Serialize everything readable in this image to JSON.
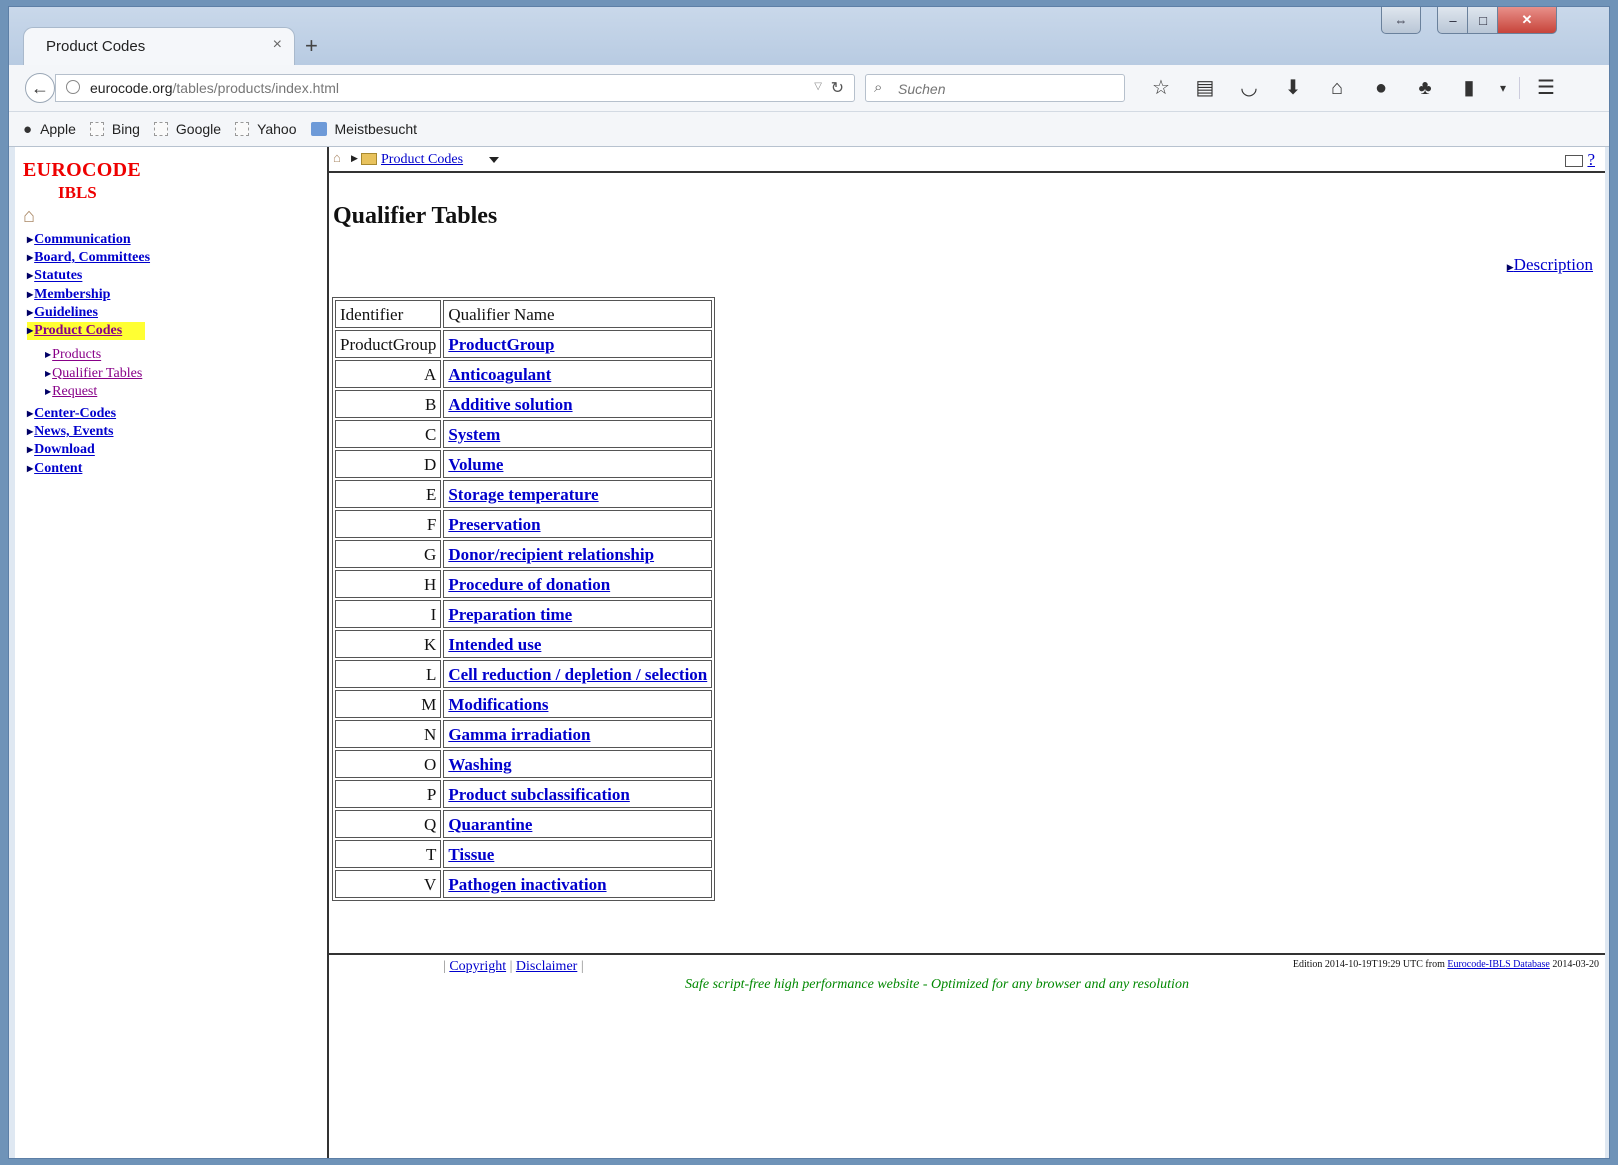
{
  "browser": {
    "tab_title": "Product Codes",
    "tab_close": "×",
    "new_tab": "+",
    "url_domain": "eurocode.org",
    "url_path": "/tables/products/index.html",
    "search_placeholder": "Suchen",
    "bookmarks": [
      "Apple",
      "Bing",
      "Google",
      "Yahoo",
      "Meistbesucht"
    ]
  },
  "sidebar": {
    "logo_line1": "EUROCODE",
    "logo_line2": "IBLS",
    "items": [
      {
        "label": "Communication"
      },
      {
        "label": "Board, Committees"
      },
      {
        "label": "Statutes"
      },
      {
        "label": "Membership"
      },
      {
        "label": "Guidelines"
      },
      {
        "label": "Product Codes"
      },
      {
        "label": "Center-Codes"
      },
      {
        "label": "News, Events"
      },
      {
        "label": "Download"
      },
      {
        "label": "Content"
      }
    ],
    "subitems": [
      {
        "label": "Products"
      },
      {
        "label": "Qualifier Tables"
      },
      {
        "label": "Request"
      }
    ]
  },
  "breadcrumb": {
    "link": "Product Codes"
  },
  "help": "?",
  "page": {
    "title": "Qualifier Tables",
    "description_link": "Description"
  },
  "table": {
    "headers": [
      "Identifier",
      "Qualifier Name"
    ],
    "rows": [
      {
        "id": "ProductGroup",
        "name": "ProductGroup"
      },
      {
        "id": "A",
        "name": "Anticoagulant"
      },
      {
        "id": "B",
        "name": "Additive solution"
      },
      {
        "id": "C",
        "name": "System"
      },
      {
        "id": "D",
        "name": "Volume"
      },
      {
        "id": "E",
        "name": "Storage temperature"
      },
      {
        "id": "F",
        "name": "Preservation"
      },
      {
        "id": "G",
        "name": "Donor/recipient relationship"
      },
      {
        "id": "H",
        "name": "Procedure of donation"
      },
      {
        "id": "I",
        "name": "Preparation time"
      },
      {
        "id": "K",
        "name": "Intended use"
      },
      {
        "id": "L",
        "name": "Cell reduction / depletion / selection"
      },
      {
        "id": "M",
        "name": "Modifications"
      },
      {
        "id": "N",
        "name": "Gamma irradiation"
      },
      {
        "id": "O",
        "name": "Washing"
      },
      {
        "id": "P",
        "name": "Product subclassification"
      },
      {
        "id": "Q",
        "name": "Quarantine"
      },
      {
        "id": "T",
        "name": "Tissue"
      },
      {
        "id": "V",
        "name": "Pathogen inactivation"
      }
    ]
  },
  "footer": {
    "copyright": "Copyright",
    "disclaimer": "Disclaimer",
    "edition_prefix": "Edition 2014-10-19T19:29 UTC from",
    "edition_link": "Eurocode-IBLS Database",
    "edition_suffix": "2014-03-20",
    "slogan": "Safe script-free high performance website - Optimized for any browser and any resolution"
  }
}
